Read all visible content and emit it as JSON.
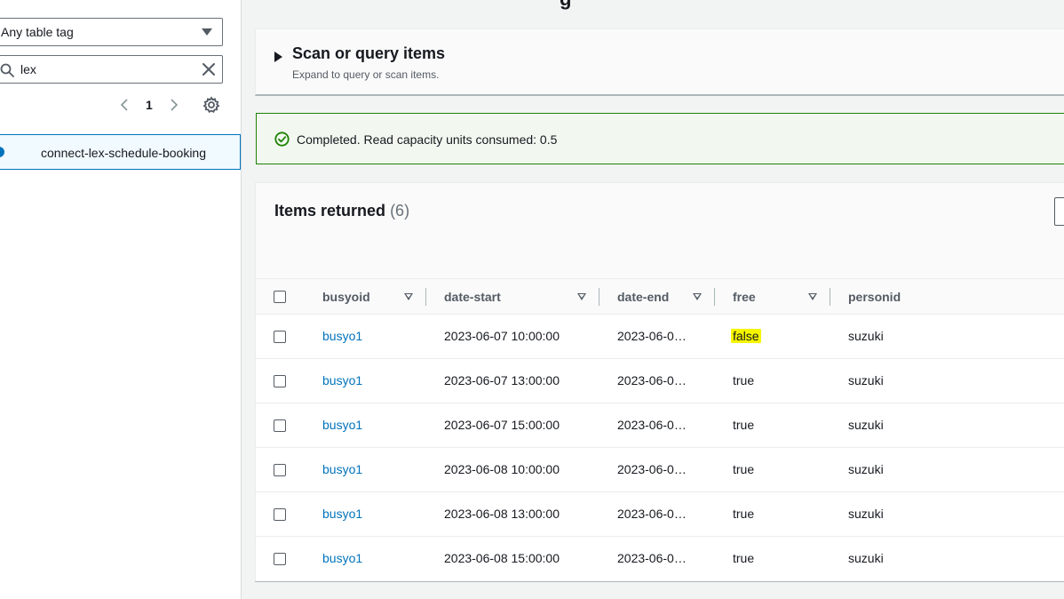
{
  "left_panel": {
    "tag_filter": {
      "selected": "Any table tag"
    },
    "search": {
      "value": "lex"
    },
    "pagination": {
      "current_page": "1"
    },
    "tables": [
      {
        "name": "connect-lex-schedule-booking",
        "selected": true
      }
    ]
  },
  "page": {
    "title_fragment": "g"
  },
  "scan_panel": {
    "title": "Scan or query items",
    "description": "Expand to query or scan items."
  },
  "status": {
    "message": "Completed. Read capacity units consumed: 0.5",
    "color": "#1d8102"
  },
  "items": {
    "title": "Items returned",
    "count": "(6)",
    "columns": [
      "busyoid",
      "date-start",
      "date-end",
      "free",
      "personid"
    ],
    "rows": [
      {
        "busyoid": "busyo1",
        "date_start": "2023-06-07 10:00:00",
        "date_end": "2023-06-0…",
        "free": "false",
        "personid": "suzuki"
      },
      {
        "busyoid": "busyo1",
        "date_start": "2023-06-07 13:00:00",
        "date_end": "2023-06-0…",
        "free": "true",
        "personid": "suzuki"
      },
      {
        "busyoid": "busyo1",
        "date_start": "2023-06-07 15:00:00",
        "date_end": "2023-06-0…",
        "free": "true",
        "personid": "suzuki"
      },
      {
        "busyoid": "busyo1",
        "date_start": "2023-06-08 10:00:00",
        "date_end": "2023-06-0…",
        "free": "true",
        "personid": "suzuki"
      },
      {
        "busyoid": "busyo1",
        "date_start": "2023-06-08 13:00:00",
        "date_end": "2023-06-0…",
        "free": "true",
        "personid": "suzuki"
      },
      {
        "busyoid": "busyo1",
        "date_start": "2023-06-08 15:00:00",
        "date_end": "2023-06-0…",
        "free": "true",
        "personid": "suzuki"
      }
    ]
  },
  "colors": {
    "link": "#0073bb",
    "highlight": "#f5f500",
    "selected_border": "#0073bb"
  }
}
